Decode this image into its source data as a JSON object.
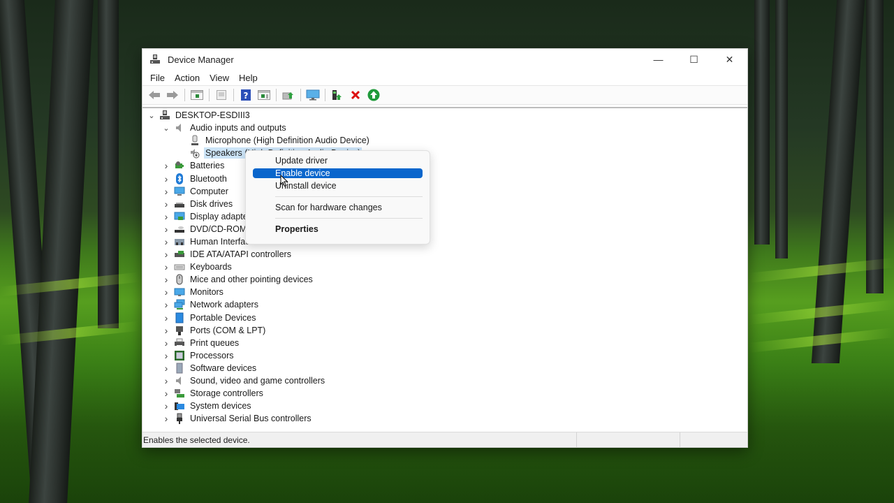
{
  "window": {
    "title": "Device Manager",
    "controls": {
      "minimize": "—",
      "maximize": "☐",
      "close": "✕"
    }
  },
  "menubar": {
    "items": [
      "File",
      "Action",
      "View",
      "Help"
    ]
  },
  "toolbar": {
    "buttons": [
      "back-icon",
      "forward-icon",
      "show-hide-console-tree-icon",
      "properties-icon",
      "help-icon",
      "show-action-pane-icon",
      "update-driver-icon",
      "scan-hardware-icon",
      "add-legacy-hardware-icon",
      "uninstall-device-icon",
      "enable-device-icon"
    ]
  },
  "tree": {
    "root": "DESKTOP-ESDIII3",
    "audio": {
      "label": "Audio inputs and outputs",
      "children": [
        "Microphone (High Definition Audio Device)",
        "Speakers (High Definition Audio Device)"
      ]
    },
    "categories": [
      "Batteries",
      "Bluetooth",
      "Computer",
      "Disk drives",
      "Display adapters",
      "DVD/CD-ROM drives",
      "Human Interface Devices",
      "IDE ATA/ATAPI controllers",
      "Keyboards",
      "Mice and other pointing devices",
      "Monitors",
      "Network adapters",
      "Portable Devices",
      "Ports (COM & LPT)",
      "Print queues",
      "Processors",
      "Software devices",
      "Sound, video and game controllers",
      "Storage controllers",
      "System devices",
      "Universal Serial Bus controllers"
    ]
  },
  "context_menu": {
    "items": [
      "Update driver",
      "Enable device",
      "Uninstall device",
      "Scan for hardware changes",
      "Properties"
    ],
    "highlighted": "Enable device"
  },
  "statusbar": {
    "text": "Enables the selected device."
  },
  "colors": {
    "highlight": "#0a66cc",
    "selection": "#cce4f7"
  }
}
